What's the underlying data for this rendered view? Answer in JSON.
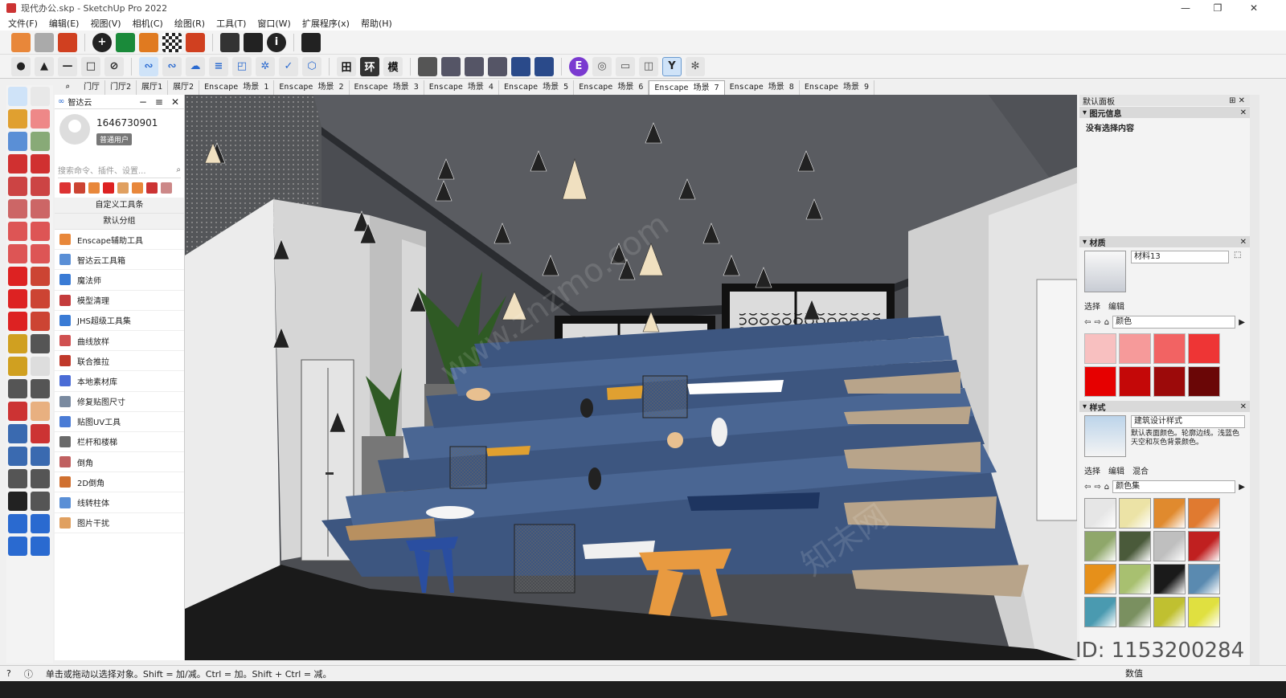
{
  "window": {
    "title": "现代办公.skp - SketchUp Pro 2022",
    "min": "—",
    "restore": "❐",
    "close": "✕"
  },
  "menu": [
    "文件(F)",
    "编辑(E)",
    "视图(V)",
    "相机(C)",
    "绘图(R)",
    "工具(T)",
    "窗口(W)",
    "扩展程序(x)",
    "帮助(H)"
  ],
  "scenes": [
    "门厅",
    "门厅2",
    "展厅1",
    "展厅2",
    "Enscape 场景 1",
    "Enscape 场景 2",
    "Enscape 场景 3",
    "Enscape 场景 4",
    "Enscape 场景 5",
    "Enscape 场景 6",
    "Enscape 场景 7",
    "Enscape 场景 8",
    "Enscape 场景 9"
  ],
  "active_scene": "Enscape 场景 7",
  "plugin_panel": {
    "title": "智达云",
    "user_id": "1646730901",
    "user_badge": "普通用户",
    "search_placeholder": "搜索命令、插件、设置...",
    "custom_toolbar": "自定义工具条",
    "default_group": "默认分组",
    "tools": [
      "Enscape辅助工具",
      "智达云工具箱",
      "魔法师",
      "模型清理",
      "JHS超级工具集",
      "曲线放样",
      "联合推拉",
      "本地素材库",
      "修复贴图尺寸",
      "贴图UV工具",
      "栏杆和楼梯",
      "倒角",
      "2D倒角",
      "线转柱体",
      "图片干扰"
    ],
    "tool_colors": [
      "#e8873a",
      "#5a8fd6",
      "#3a7bd5",
      "#c43b3b",
      "#3a7bd5",
      "#d05050",
      "#c0392b",
      "#4a6cd6",
      "#7a8aa0",
      "#4a7bd5",
      "#6a6a6a",
      "#c06060",
      "#d07030",
      "#5a8fd6",
      "#e0a060"
    ]
  },
  "right_panel": {
    "title": "默认面板",
    "entity_section": "图元信息",
    "entity_text": "没有选择内容",
    "materials_section": "材质",
    "material_name": "材料13",
    "tab_select": "选择",
    "tab_edit": "编辑",
    "material_category": "颜色",
    "material_swatches": [
      "#f8c0c0",
      "#f69a9a",
      "#f26363",
      "#ee3535",
      "#e60000",
      "#c40808",
      "#9c0a0a",
      "#6a0606"
    ],
    "styles_section": "样式",
    "style_name": "建筑设计样式",
    "style_desc": "默认表面颜色。轮廓边线。浅蓝色天空和灰色背景颜色。",
    "tab_mix": "混合",
    "style_category": "颜色集",
    "style_swatches": [
      "#e6e6e6",
      "#ece3a6",
      "#e08a2e",
      "#e07a30",
      "#8fa76a",
      "#4a5a3a",
      "#bfbfbf",
      "#c02020",
      "#e6901a",
      "#a8c070",
      "#1a1a1a",
      "#5a8ab0",
      "#4a9ab0",
      "#7a9060",
      "#c0c030",
      "#e0e040"
    ]
  },
  "status": {
    "hint": "单击或拖动以选择对象。Shift = 加/减。Ctrl = 加。Shift + Ctrl = 减。",
    "values_label": "数值"
  },
  "watermark": {
    "id": "ID: 1153200284",
    "site": "www.znzmo.com",
    "brand": "知末网"
  }
}
